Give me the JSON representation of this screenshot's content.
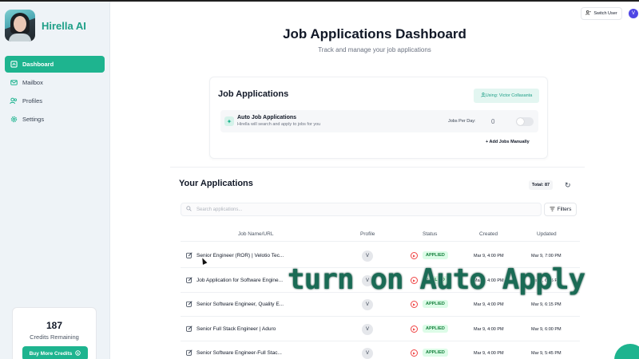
{
  "brand": {
    "name": "Hirella AI"
  },
  "sidebar": {
    "items": [
      {
        "label": "Dashboard",
        "icon": "dashboard-icon",
        "active": true
      },
      {
        "label": "Mailbox",
        "icon": "mail-icon",
        "active": false
      },
      {
        "label": "Profiles",
        "icon": "users-icon",
        "active": false
      },
      {
        "label": "Settings",
        "icon": "gear-icon",
        "active": false
      }
    ],
    "credits": {
      "count": "187",
      "label": "Credits Remaining",
      "button": "Buy More Credits"
    }
  },
  "header": {
    "switch_user": "Switch User",
    "user_initial": "V"
  },
  "page": {
    "title": "Job Applications Dashboard",
    "subtitle": "Track and manage your job applications"
  },
  "jobs_card": {
    "title": "Job Applications",
    "using": "Using: Victor Collasanta",
    "auto": {
      "title": "Auto Job Applications",
      "desc": "Hirella will search and apply to jobs for you",
      "jobs_per_day_label": "Jobs Per Day:",
      "jobs_per_day_value": "0",
      "enabled": false
    },
    "add_manual": "+ Add Jobs Manually"
  },
  "applications": {
    "title": "Your Applications",
    "total": "Total: 87",
    "search_placeholder": "Search applications...",
    "filters": "Filters",
    "columns": {
      "name": "Job Name/URL",
      "profile": "Profile",
      "status": "Status",
      "created": "Created",
      "updated": "Updated"
    },
    "rows": [
      {
        "name": "Senior Engineer (ROR) | Velotio Tec...",
        "profile": "V",
        "status": "APPLIED",
        "created": "Mar 9, 4:00 PM",
        "updated": "Mar 9, 7:00 PM"
      },
      {
        "name": "Job Application for Software Engine...",
        "profile": "V",
        "status": "APPLIED",
        "created": "Mar 9, 4:00 PM",
        "updated": "Mar 9, 6:45 PM"
      },
      {
        "name": "Senior Software Engineer, Quality E...",
        "profile": "V",
        "status": "APPLIED",
        "created": "Mar 9, 4:00 PM",
        "updated": "Mar 9, 6:15 PM"
      },
      {
        "name": "Senior Full Stack Engineer | Aduro",
        "profile": "V",
        "status": "APPLIED",
        "created": "Mar 9, 4:00 PM",
        "updated": "Mar 9, 6:00 PM"
      },
      {
        "name": "Senior Software Engineer-Full Stac...",
        "profile": "V",
        "status": "APPLIED",
        "created": "Mar 9, 4:00 PM",
        "updated": "Mar 9, 5:45 PM"
      }
    ]
  },
  "overlay_caption": "turn on Auto Apply",
  "colors": {
    "accent": "#1eb48f",
    "brand_text": "#1e9f87",
    "applied_bg": "#dcfce7",
    "applied_text": "#15803d",
    "status_icon": "#ef4444"
  }
}
